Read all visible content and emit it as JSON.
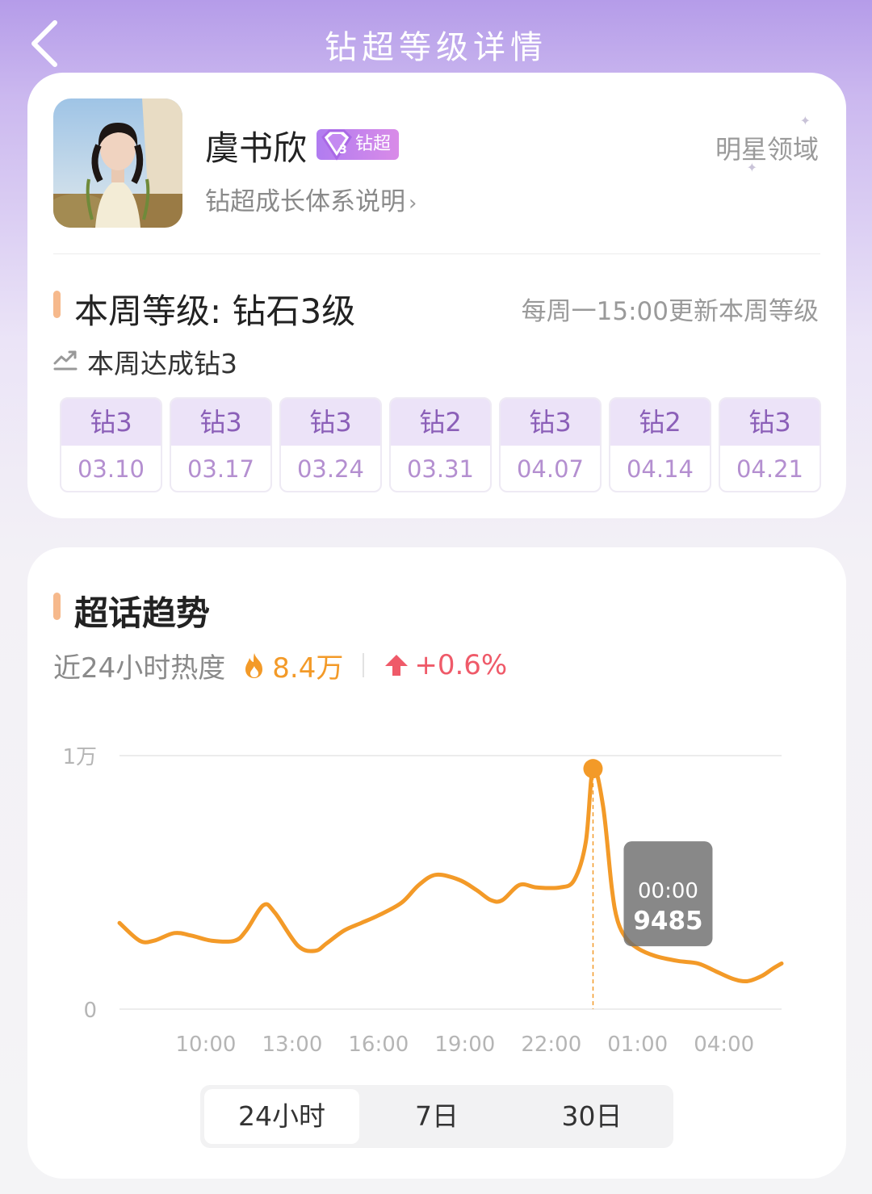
{
  "header": {
    "title": "钻超等级详情",
    "back_icon": "back-chevron-icon"
  },
  "profile": {
    "name": "虞书欣",
    "badge_label": "钻超",
    "badge_icon": "diamond-gem-icon",
    "badge_colors": [
      "#b07cf0",
      "#d98be8"
    ],
    "growth_link": "钻超成长体系说明",
    "domain": "明星领域"
  },
  "level": {
    "title": "本周等级: 钻石3级",
    "update_note": "每周一15:00更新本周等级",
    "achieved": "本周达成钻3",
    "weeks": [
      {
        "level": "钻3",
        "date": "03.10"
      },
      {
        "level": "钻3",
        "date": "03.17"
      },
      {
        "level": "钻3",
        "date": "03.24"
      },
      {
        "level": "钻2",
        "date": "03.31"
      },
      {
        "level": "钻3",
        "date": "04.07"
      },
      {
        "level": "钻2",
        "date": "04.14"
      },
      {
        "level": "钻3",
        "date": "04.21"
      }
    ]
  },
  "trend": {
    "title": "超话趋势",
    "heat_label": "近24小时热度",
    "heat_value": "8.4万",
    "heat_change": "+0.6%",
    "accent_color": "#f39a28",
    "up_color": "#ef5a69"
  },
  "chart_data": {
    "type": "line",
    "color": "#f39a28",
    "ylim": [
      0,
      10000
    ],
    "y_tick_labels": [
      "0",
      "1万"
    ],
    "x_tick_labels": [
      "10:00",
      "13:00",
      "16:00",
      "19:00",
      "22:00",
      "01:00",
      "04:00"
    ],
    "x_ticks": [
      3,
      6,
      9,
      12,
      15,
      18,
      21
    ],
    "xlim": [
      0,
      23
    ],
    "series": [
      {
        "x": [
          0,
          0.7,
          1.2,
          1.9,
          2.5,
          3.2,
          4.0,
          4.4,
          5.0,
          5.4,
          6.2,
          6.8,
          7.2,
          7.8,
          8.4,
          9.0,
          9.8,
          10.4,
          11.0,
          11.8,
          12.4,
          12.9,
          13.3,
          13.9,
          14.5,
          15.3,
          15.8,
          16.2,
          16.45,
          16.8,
          17.1,
          17.3,
          17.6,
          18.0,
          18.6,
          19.4,
          20.1,
          20.7,
          21.3,
          21.8,
          22.3,
          22.7,
          23.0
        ],
        "y": [
          3400,
          2700,
          2700,
          3000,
          2900,
          2700,
          2700,
          3100,
          4100,
          3800,
          2500,
          2300,
          2600,
          3100,
          3400,
          3700,
          4200,
          4900,
          5300,
          5100,
          4700,
          4300,
          4300,
          4900,
          4800,
          4800,
          5100,
          6600,
          9485,
          8000,
          4800,
          3500,
          2800,
          2400,
          2100,
          1900,
          1800,
          1500,
          1200,
          1100,
          1300,
          1600,
          1800
        ]
      }
    ],
    "tooltip": {
      "time": "00:00",
      "value": "9485"
    },
    "highlight": {
      "x": 16.45,
      "y": 9485
    }
  },
  "range_tabs": {
    "items": [
      "24小时",
      "7日",
      "30日"
    ],
    "active": 0
  }
}
